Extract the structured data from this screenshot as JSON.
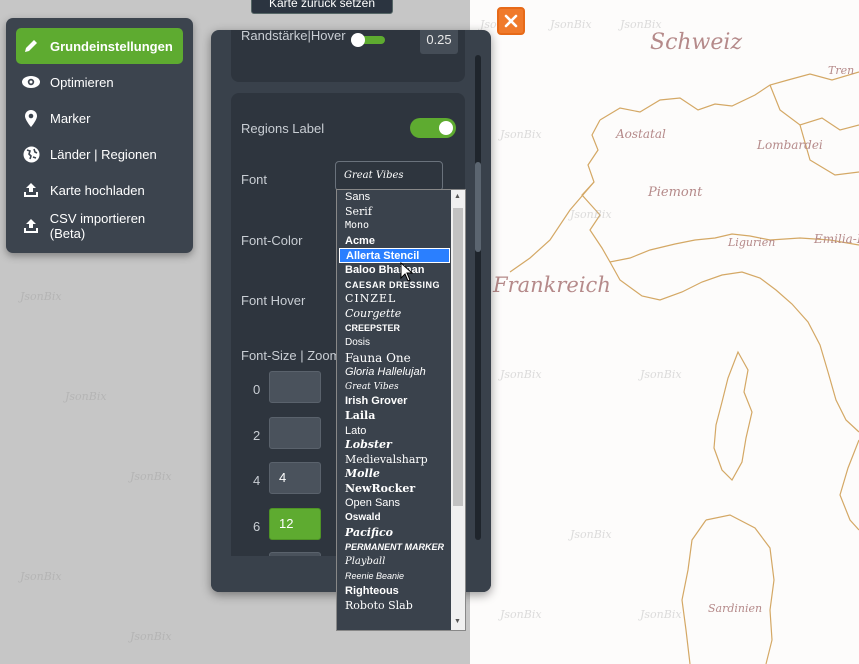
{
  "reset_button": {
    "label": "Karte zurück setzen"
  },
  "close_button": {
    "icon": "close-icon",
    "color": "#f07a2b"
  },
  "menu": {
    "items": [
      {
        "label": "Grundeinstellungen",
        "icon": "pencil-icon",
        "active": true
      },
      {
        "label": "Optimieren",
        "icon": "eye-icon",
        "active": false
      },
      {
        "label": "Marker",
        "icon": "map-pin-icon",
        "active": false
      },
      {
        "label": "Länder | Regionen",
        "icon": "globe-icon",
        "active": false
      },
      {
        "label": "Karte hochladen",
        "icon": "upload-icon",
        "active": false
      },
      {
        "label": "CSV importieren (Beta)",
        "icon": "upload-icon",
        "active": false
      }
    ]
  },
  "panel": {
    "border_hover_label": "Randstärke|Hover",
    "border_hover_value": "0.25",
    "regions_label": "Regions Label",
    "regions_label_enabled": true,
    "font_label": "Font",
    "font_value": "Great Vibes",
    "font_color_label": "Font-Color",
    "font_hover_label": "Font Hover",
    "font_size_zoom_label": "Font-Size | Zoom",
    "zoom_rows": [
      {
        "zoom": "0",
        "value": ""
      },
      {
        "zoom": "2",
        "value": ""
      },
      {
        "zoom": "4",
        "value": "4"
      },
      {
        "zoom": "6",
        "value": "12"
      }
    ]
  },
  "font_dropdown": {
    "selected": "Allerta Stencil",
    "options": [
      "Sans",
      "Serif",
      "Mono",
      "Acme",
      "Allerta Stencil",
      "Baloo Bhaijaan",
      "CAESAR DRESSING",
      "CINZEL",
      "Courgette",
      "CREEPSTER",
      "Dosis",
      "Fauna One",
      "Gloria Hallelujah",
      "Great Vibes",
      "Irish Grover",
      "Laila",
      "Lato",
      "Lobster",
      "Medievalsharp",
      "Molle",
      "NewRocker",
      "Open Sans",
      "Oswald",
      "Pacifico",
      "PERMANENT MARKER",
      "Playball",
      "Reenie Beanie",
      "Righteous",
      "Roboto Slab"
    ]
  },
  "map": {
    "labels": [
      "Schweiz",
      "Aostatal",
      "Lombardei",
      "Piemont",
      "Ligurien",
      "Emilia-R",
      "Frankreich",
      "Sardinien",
      "Tren"
    ],
    "watermark": "JsonBix"
  },
  "colors": {
    "accent": "#5eab30",
    "panel": "#39414b",
    "card": "#2e353e",
    "border_line": "#d4a865"
  }
}
